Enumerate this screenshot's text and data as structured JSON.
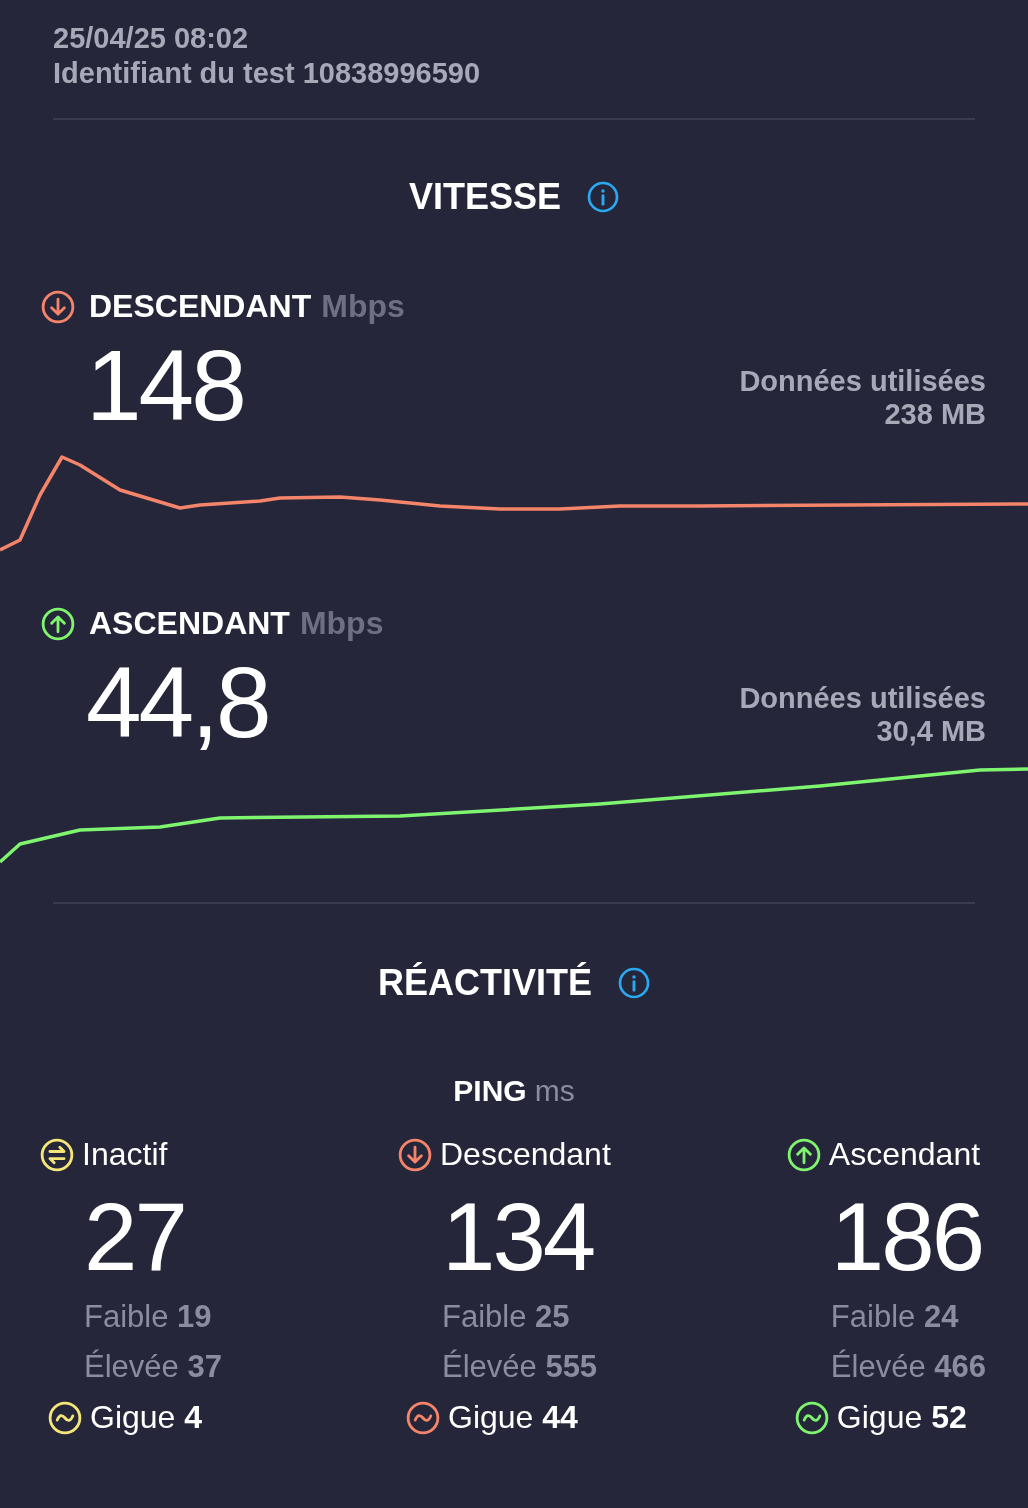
{
  "header": {
    "date": "25/04/25 08:02",
    "test_id": "Identifiant du test 10838996590"
  },
  "speed": {
    "title": "VITESSE",
    "results": [
      {
        "kind": "download",
        "label": "DESCENDANT",
        "unit": "Mbps",
        "value": "148",
        "data_label": "Données utilisées",
        "data_value": "238 MB"
      },
      {
        "kind": "upload",
        "label": "ASCENDANT",
        "unit": "Mbps",
        "value": "44,8",
        "data_label": "Données utilisées",
        "data_value": "30,4 MB"
      }
    ]
  },
  "responsiveness": {
    "title": "RÉACTIVITÉ",
    "ping_label": "PING",
    "ping_unit": "ms",
    "columns": [
      {
        "kind": "idle",
        "label": "Inactif",
        "value": "27",
        "low": "Faible **19**",
        "high": "Élevée **37**",
        "jitter": "Gigue **4**"
      },
      {
        "kind": "download",
        "label": "Descendant",
        "value": "134",
        "low": "Faible **25**",
        "high": "Élevée **555**",
        "jitter": "Gigue **44**"
      },
      {
        "kind": "upload",
        "label": "Ascendant",
        "value": "186",
        "low": "Faible **24**",
        "high": "Élevée **466**",
        "jitter": "Gigue **52**"
      }
    ]
  }
}
